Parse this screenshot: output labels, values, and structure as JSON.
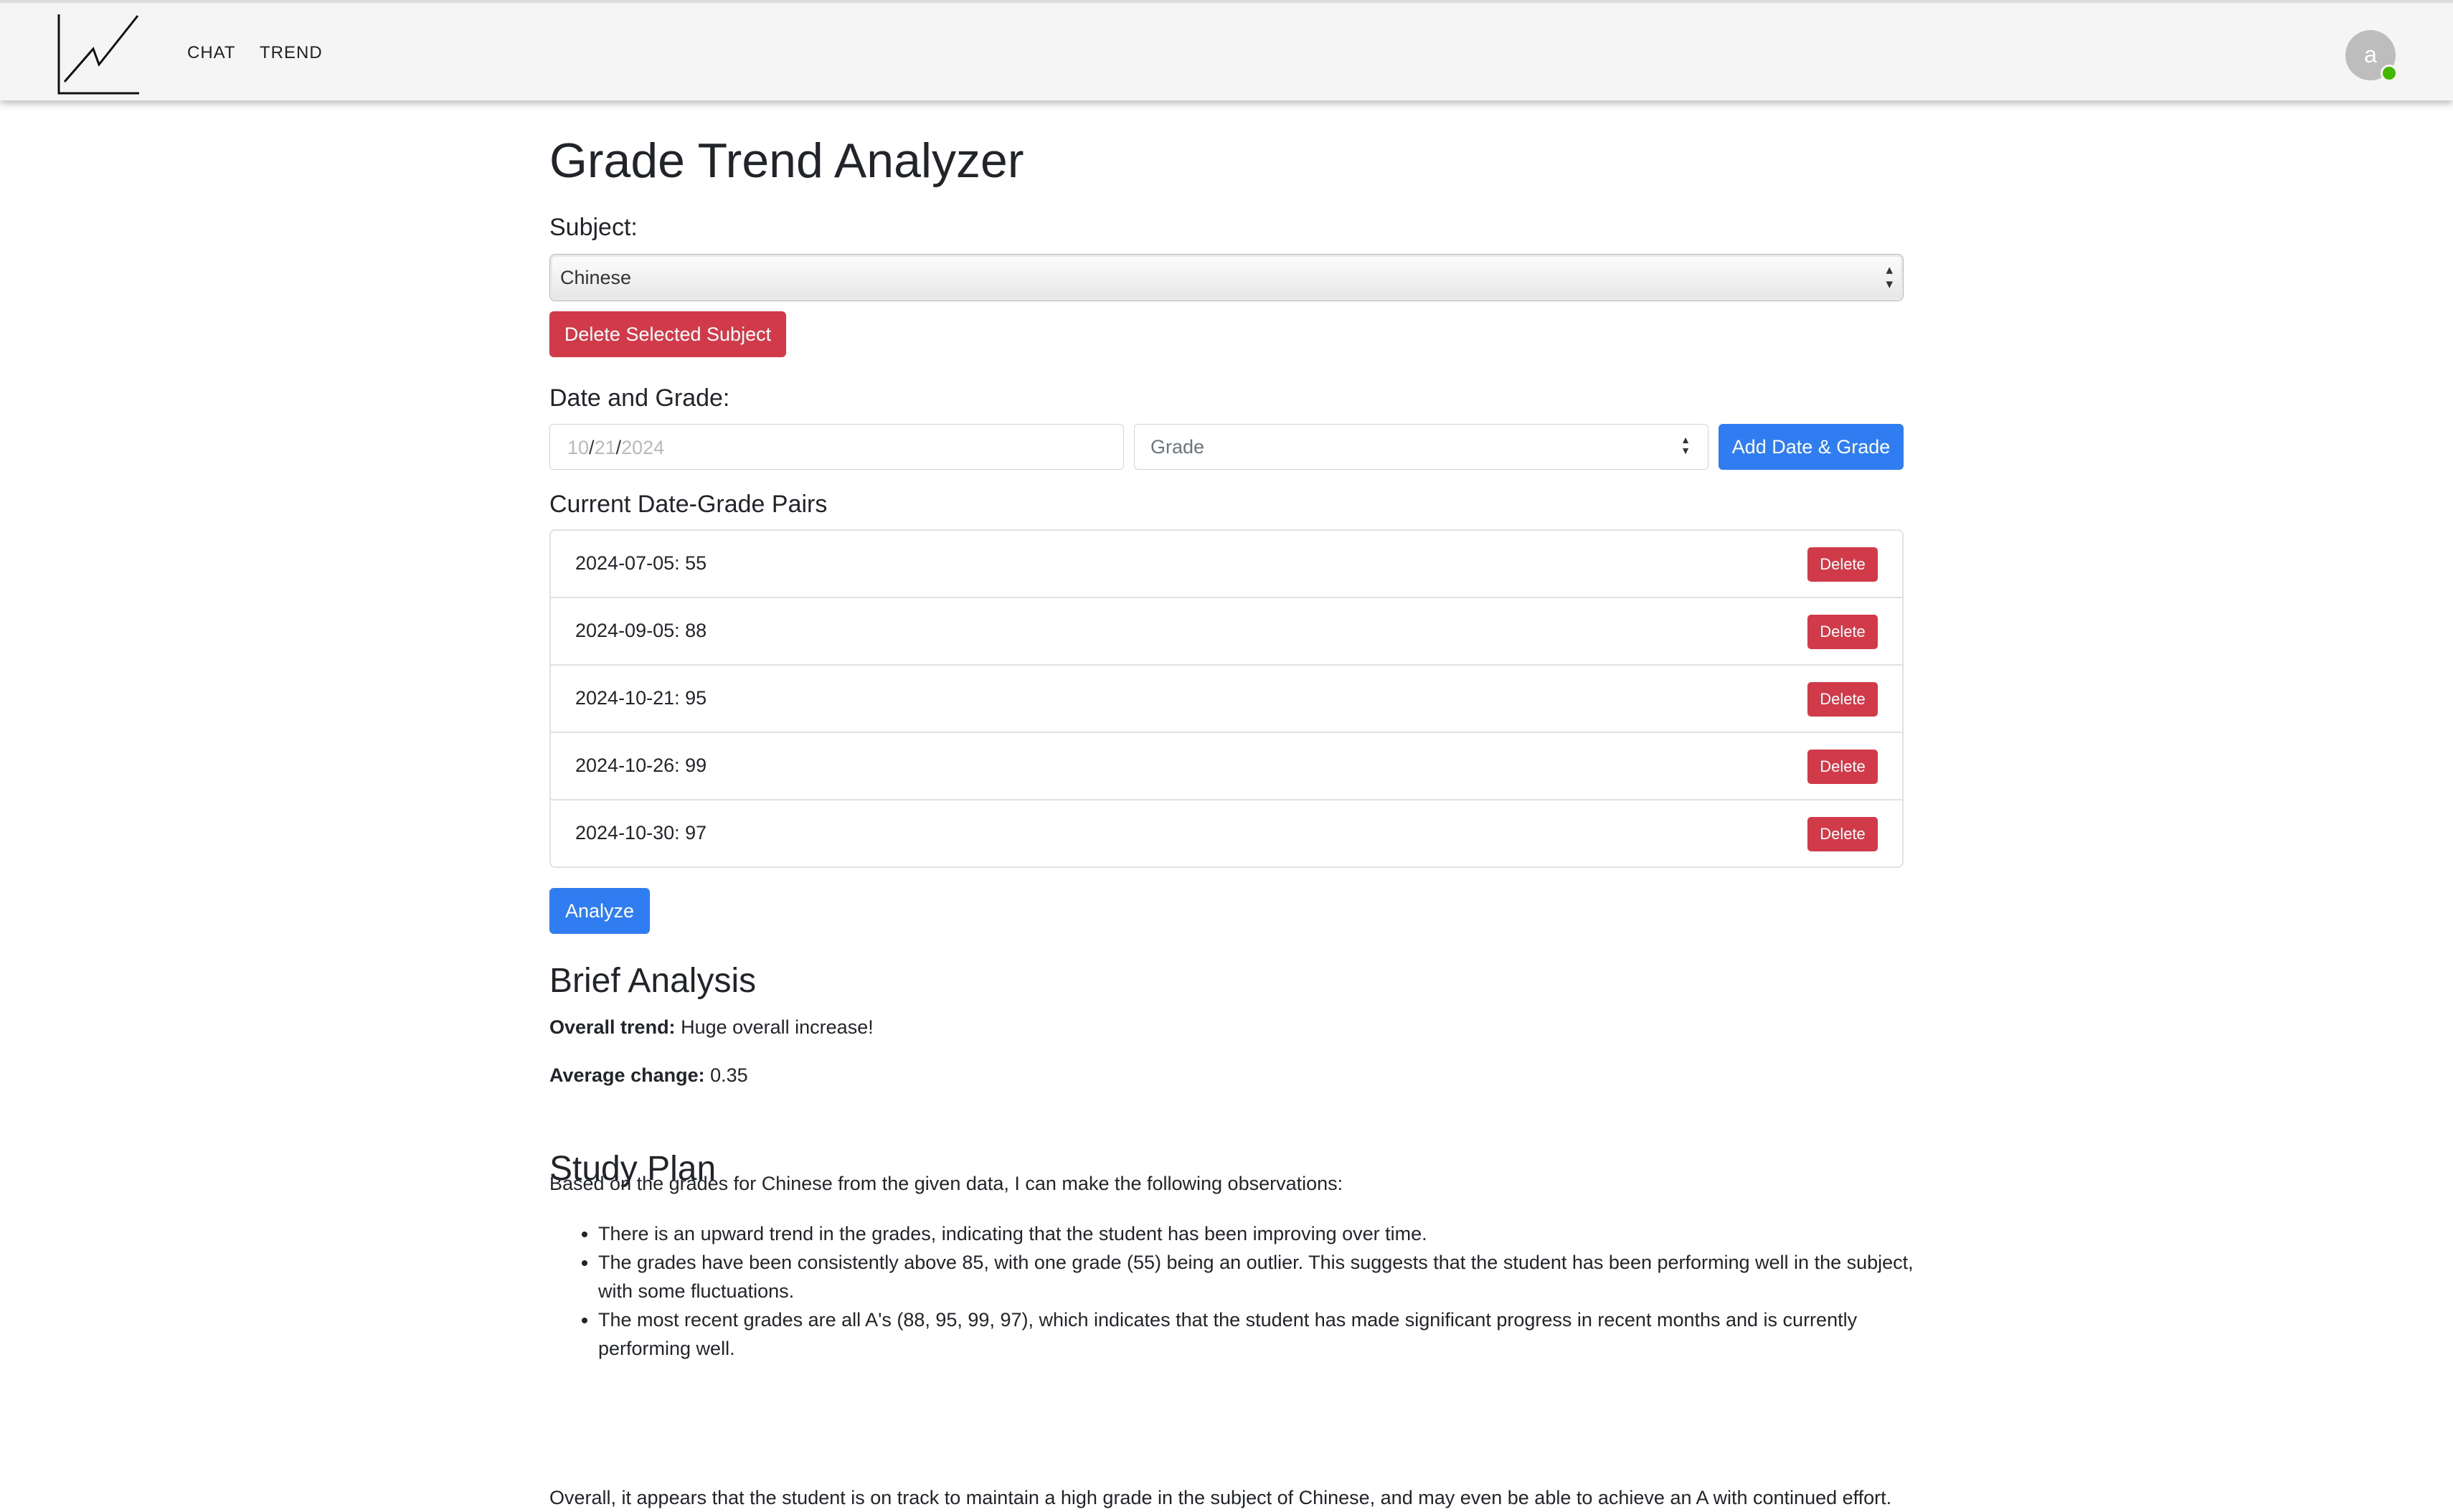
{
  "nav": {
    "items": [
      "CHAT",
      "TREND"
    ],
    "avatar_initial": "a"
  },
  "page": {
    "title": "Grade Trend Analyzer"
  },
  "subject": {
    "label": "Subject:",
    "selected": "Chinese",
    "delete_button": "Delete Selected Subject"
  },
  "entry": {
    "label": "Date and Grade:",
    "date_month": "10",
    "date_day": "21",
    "date_year": "2024",
    "date_separator": "/",
    "grade_placeholder": "Grade",
    "add_button": "Add Date & Grade"
  },
  "pairs": {
    "title": "Current Date-Grade Pairs",
    "delete_label": "Delete",
    "items": [
      "2024-07-05: 55",
      "2024-09-05: 88",
      "2024-10-21: 95",
      "2024-10-26: 99",
      "2024-10-30: 97"
    ]
  },
  "analyze_button": "Analyze",
  "analysis": {
    "title": "Brief Analysis",
    "trend_label": "Overall trend:",
    "trend_value": "Huge overall increase!",
    "change_label": "Average change:",
    "change_value": "0.35"
  },
  "plan": {
    "title": "Study Plan",
    "intro": "Based on the grades for Chinese from the given data, I can make the following observations:",
    "bullets": [
      "There is an upward trend in the grades, indicating that the student has been improving over time.",
      "The grades have been consistently above 85, with one grade (55) being an outlier. This suggests that the student has been performing well in the subject, with some fluctuations.",
      "The most recent grades are all A's (88, 95, 99, 97), which indicates that the student has made significant progress in recent months and is currently performing well."
    ],
    "conclusion": "Overall, it appears that the student is on track to maintain a high grade in the subject of Chinese, and may even be able to achieve an A with continued effort."
  },
  "colors": {
    "primary": "#2f7df0",
    "danger": "#d13a48",
    "status_online": "#44b700"
  }
}
